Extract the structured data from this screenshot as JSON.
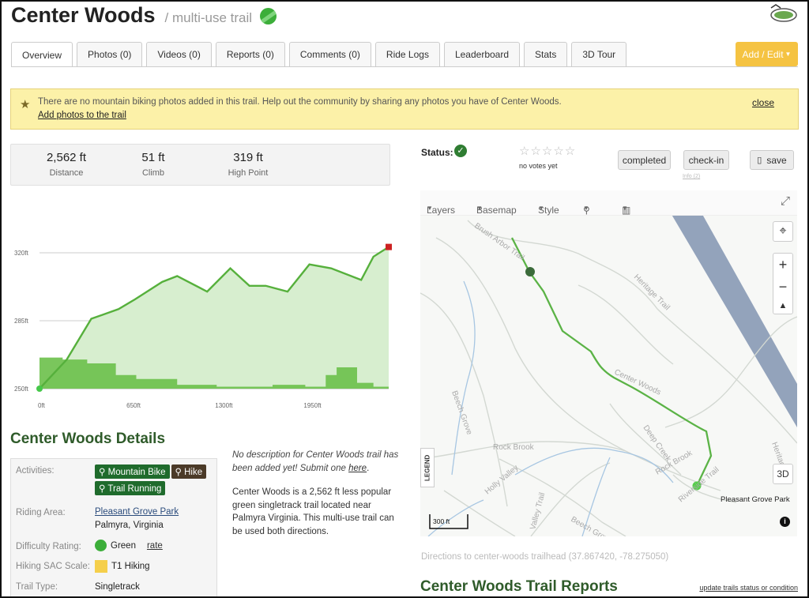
{
  "header": {
    "title": "Center Woods",
    "subtitle": "/ multi-use trail"
  },
  "tabs": [
    {
      "label": "Overview"
    },
    {
      "label": "Photos (0)"
    },
    {
      "label": "Videos (0)"
    },
    {
      "label": "Reports (0)"
    },
    {
      "label": "Comments (0)"
    },
    {
      "label": "Ride Logs"
    },
    {
      "label": "Leaderboard"
    },
    {
      "label": "Stats"
    },
    {
      "label": "3D Tour"
    }
  ],
  "add_edit": "Add / Edit",
  "banner": {
    "message": "There are no mountain biking photos added in this trail. Help out the community by sharing any photos you have of Center Woods.",
    "link": "Add photos to the trail",
    "close": "close"
  },
  "stats": [
    {
      "value": "2,562 ft",
      "label": "Distance"
    },
    {
      "value": "51 ft",
      "label": "Climb"
    },
    {
      "value": "319 ft",
      "label": "High Point"
    }
  ],
  "chart_data": {
    "type": "area",
    "yticks": [
      "320ft",
      "285ft",
      "250ft"
    ],
    "xticks": [
      "0ft",
      "650ft",
      "1300ft",
      "1950ft"
    ],
    "ylim": [
      250,
      320
    ],
    "xlim": [
      0,
      2562
    ],
    "elevation": {
      "x": [
        0,
        200,
        380,
        580,
        700,
        900,
        1010,
        1230,
        1400,
        1540,
        1660,
        1820,
        1980,
        2140,
        2360,
        2450,
        2562
      ],
      "y": [
        250,
        265,
        286,
        291,
        296,
        305,
        308,
        300,
        312,
        303,
        303,
        300,
        314,
        312,
        306,
        318,
        323
      ]
    },
    "grade": {
      "x": [
        0,
        170,
        350,
        560,
        710,
        1010,
        1300,
        1550,
        1710,
        1950,
        2100,
        2180,
        2330,
        2450
      ],
      "y": [
        266,
        265,
        263,
        257,
        255,
        252,
        251,
        251,
        252,
        251,
        257,
        261,
        253,
        251
      ]
    }
  },
  "details": {
    "title": "Center Woods Details",
    "activities_label": "Activities:",
    "activities": [
      "Mountain Bike",
      "Hike",
      "Trail Running"
    ],
    "riding_area_label": "Riding Area:",
    "riding_area": "Pleasant Grove Park",
    "riding_area_location": "Palmyra, Virginia",
    "difficulty_label": "Difficulty Rating:",
    "difficulty": "Green",
    "rate": "rate",
    "sac_label": "Hiking SAC Scale:",
    "sac": "T1 Hiking",
    "type_label": "Trail Type:",
    "type": "Singletrack"
  },
  "description": {
    "none_text": "No description for Center Woods trail has been added yet! Submit one",
    "here": "here",
    "period": ".",
    "summary": "Center Woods is a 2,562 ft less popular green singletrack trail located near Palmyra Virginia. This multi-use trail can be used both directions."
  },
  "status": {
    "label": "Status:",
    "votes": "no votes yet"
  },
  "buttons": {
    "completed": "completed",
    "checkin": "check-in",
    "save": "save",
    "checkin_sub": "Info (2)"
  },
  "map": {
    "layers": "Layers",
    "basemap": "Basemap",
    "style": "Style",
    "legend": "LEGEND",
    "scale": "300 ft",
    "label_3d": "3D",
    "place": "Pleasant Grove Park",
    "labels": [
      "Brush Arbor Trail",
      "Heritage Trail",
      "Center Woods",
      "Beech Grove",
      "Rock Brook",
      "Deep Creek",
      "Riverside Trail",
      "Rock Brook",
      "Beech Grove",
      "Heritage",
      "Holly Valley",
      "Valley Trail"
    ]
  },
  "directions": "Directions to center-woods trailhead (37.867420, -78.275050)",
  "reports": {
    "title": "Center Woods Trail Reports",
    "link": "update trails status or condition"
  },
  "colors": {
    "accent_green": "#3cae3a",
    "title_green": "#2f5b2a",
    "banner": "#fcf1a8",
    "add_edit": "#f5c342",
    "river": "#9aa9c1"
  }
}
